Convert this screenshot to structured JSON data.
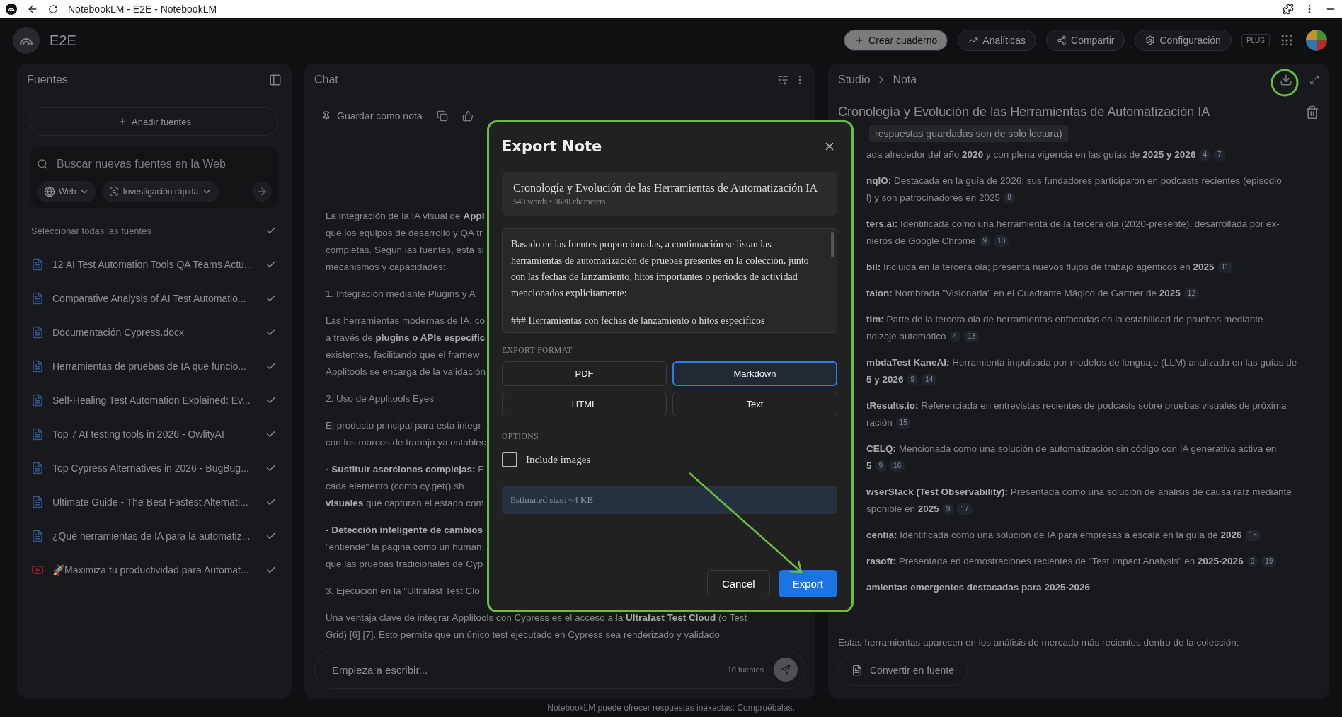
{
  "browser": {
    "tab_title": "NotebookLM - E2E - NotebookLM"
  },
  "header": {
    "notebook": "E2E",
    "create": "Crear cuaderno",
    "analytics": "Analíticas",
    "share": "Compartir",
    "settings": "Configuración",
    "plan": "PLUS"
  },
  "sources": {
    "title": "Fuentes",
    "add": "Añadir fuentes",
    "search_placeholder": "Buscar nuevas fuentes en la Web",
    "web": "Web",
    "research": "Investigación rápida",
    "select_all": "Seleccionar todas las fuentes",
    "select_all_checked": true,
    "items": [
      {
        "kind": "web",
        "title": "12 AI Test Automation Tools QA Teams Actu...",
        "checked": true
      },
      {
        "kind": "web",
        "title": "Comparative Analysis of AI Test Automatio...",
        "checked": true
      },
      {
        "kind": "web",
        "title": "Documentación Cypress.docx",
        "checked": true
      },
      {
        "kind": "web",
        "title": "Herramientas de pruebas de IA que funcio...",
        "checked": true
      },
      {
        "kind": "web",
        "title": "Self-Healing Test Automation Explained: Ev...",
        "checked": true
      },
      {
        "kind": "web",
        "title": "Top 7 AI testing tools in 2026 - OwlityAI",
        "checked": true
      },
      {
        "kind": "web",
        "title": "Top Cypress Alternatives in 2026 - BugBug...",
        "checked": true
      },
      {
        "kind": "web",
        "title": "Ultimate Guide - The Best Fastest Alternati...",
        "checked": true
      },
      {
        "kind": "web",
        "title": "¿Qué herramientas de IA para la automatiz...",
        "checked": true
      },
      {
        "kind": "video",
        "title": "🚀Maximiza tu productividad para Automat...",
        "checked": true
      }
    ]
  },
  "chat": {
    "title": "Chat",
    "save_note": "Guardar como nota",
    "paragraphs": [
      [
        "La integración de la IA visual de **Appl**",
        "que los equipos de desarrollo y QA tr",
        "completas. Según las fuentes, esta si",
        "mecanismos y capacidades:"
      ],
      [
        "1. Integración mediante Plugins y A"
      ],
      [
        "Las herramientas modernas de IA, co",
        "a través de **plugins o APIs específic**",
        "existentes, facilitando que el framew",
        "Applitools se encarga de la validación"
      ],
      [
        "2. Uso de Applitools Eyes"
      ],
      [
        "El producto principal para esta integr",
        "con los marcos de trabajo ya establec"
      ],
      [
        "**- Sustituir aserciones complejas:** E",
        "cada elemento (como cy.get().sh",
        "**visuales** que capturan el estado com"
      ],
      [
        "**- Detección inteligente de cambios**",
        "\"entiende\" la página como un human",
        "que las pruebas tradicionales de Cyp"
      ],
      [
        "3. Ejecución en la \"Ultrafast Test Clo"
      ]
    ],
    "after": [
      "Una ventaja clave de integrar Applitools con Cypress es el acceso a la **Ultrafast Test Cloud** (o Test",
      "Grid) [6] [7]. Esto permite que un único test ejecutado en Cypress sea renderizado y validado"
    ],
    "input_placeholder": "Empieza a escribir...",
    "source_count": "10 fuentes"
  },
  "studio": {
    "crumb_root": "Studio",
    "crumb_leaf": "Nota",
    "note_title": "Cronología y Evolución de las Herramientas de Automatización IA",
    "readonly": "respuestas guardadas son de solo lectura)",
    "paragraphs": [
      [
        {
          "text": "ada alrededor del año **2020** y con plena vigencia en las guías de **2025 y 2026**",
          "refs": [
            "4",
            "7"
          ]
        }
      ],
      [
        {
          "text": "**nqIO:** Destacada en la guía de 2026; sus fundadores participaron en podcasts recientes (episodio"
        },
        {
          "text": "l) y son patrocinadores en 2025",
          "refs": [
            "8"
          ]
        }
      ],
      [
        {
          "text": "**ters.ai:** Identificada como una herramienta de la tercera ola (2020-presente), desarrollada por ex-"
        },
        {
          "text": "nieros de Google Chrome",
          "refs": [
            "9",
            "10"
          ]
        }
      ],
      [
        {
          "text": "**bil:** Incluida en la tercera ola; presenta nuevos flujos de trabajo agénticos en **2025**",
          "refs": [
            "11"
          ]
        }
      ],
      [
        {
          "text": "**talon:** Nombrada \"Visionaria\" en el Cuadrante Mágico de Gartner de **2025**",
          "refs": [
            "12"
          ]
        }
      ],
      [
        {
          "text": "**tim:** Parte de la tercera ola de herramientas enfocadas en la estabilidad de pruebas mediante"
        },
        {
          "text": "ndizaje automático",
          "refs": [
            "4",
            "13"
          ]
        }
      ],
      [
        {
          "text": "**mbdaTest KaneAI:** Herramienta impulsada por modelos de lenguaje (LLM) analizada en las guías de"
        },
        {
          "text": "**5 y 2026**",
          "refs": [
            "9",
            "14"
          ]
        }
      ],
      [
        {
          "text": "**tResults.io:** Referenciada en entrevistas recientes de podcasts sobre pruebas visuales de próxima"
        },
        {
          "text": "ración",
          "refs": [
            "15"
          ]
        }
      ],
      [
        {
          "text": "**CELQ:** Mencionada como una solución de automatización sin código con IA generativa activa en"
        },
        {
          "text": "**5**",
          "refs": [
            "9",
            "16"
          ]
        }
      ],
      [
        {
          "text": "**wserStack (Test Observability):** Presentada como una solución de análisis de causa raíz mediante"
        },
        {
          "text": "sponible en **2025**",
          "refs": [
            "9",
            "17"
          ]
        }
      ],
      [
        {
          "text": "**centia:** Identificada como una solución de IA para empresas a escala en la guía de **2026**",
          "refs": [
            "18"
          ]
        }
      ],
      [
        {
          "text": "**rasoft:** Presentada en demostraciones recientes de \"Test Impact Analysis\" en **2025-2026**",
          "refs": [
            "9",
            "19"
          ]
        }
      ],
      [
        {
          "text": "**amientas emergentes destacadas para 2025-2026**"
        }
      ]
    ],
    "closing": "Estas herramientas aparecen en los análisis de mercado más recientes dentro de la colección:",
    "convert": "Convertir en fuente"
  },
  "footer": "NotebookLM puede ofrecer respuestas inexactas. Compruébalas.",
  "dialog": {
    "title": "Export Note",
    "note_title": "Cronología y Evolución de las Herramientas de Automatización IA",
    "meta": "540 words • 3630 characters",
    "preview": [
      "Basado en las fuentes proporcionadas, a continuación se listan las herramientas de automatización de pruebas presentes en la colección, junto con las fechas de lanzamiento, hitos importantes o periodos de actividad mencionados explícitamente:",
      "### Herramientas con fechas de lanzamiento o hitos específicos"
    ],
    "format_label": "EXPORT FORMAT",
    "formats": [
      {
        "label": "PDF",
        "selected": false
      },
      {
        "label": "Markdown",
        "selected": true
      },
      {
        "label": "HTML",
        "selected": false
      },
      {
        "label": "Text",
        "selected": false
      }
    ],
    "options_label": "OPTIONS",
    "include_images": {
      "label": "Include images",
      "checked": false
    },
    "estimate": "Estimated size: ~4 KB",
    "cancel": "Cancel",
    "export": "Export"
  }
}
